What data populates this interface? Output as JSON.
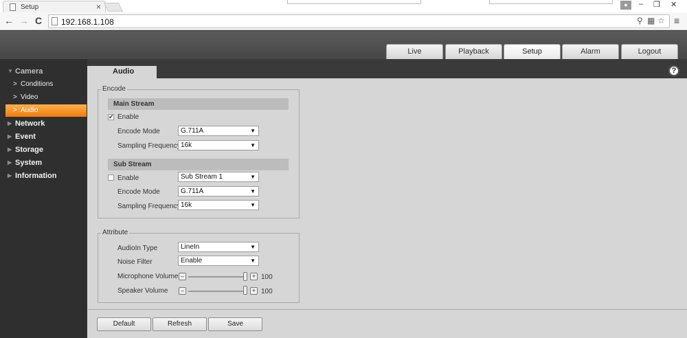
{
  "browser": {
    "tab_title": "Setup",
    "tab_close": "×",
    "back": "←",
    "forward": "→",
    "reload": "C",
    "url": "192.168.1.108",
    "menu": "≡",
    "window_controls": {
      "minimize": "–",
      "restore": "❐",
      "close": "✕"
    }
  },
  "topnav": [
    {
      "label": "Live"
    },
    {
      "label": "Playback"
    },
    {
      "label": "Setup",
      "active": true
    },
    {
      "label": "Alarm"
    },
    {
      "label": "Logout"
    }
  ],
  "sidebar": {
    "camera": "Camera",
    "conditions": "Conditions",
    "video": "Video",
    "audio": "Audio",
    "network": "Network",
    "event": "Event",
    "storage": "Storage",
    "system": "System",
    "information": "Information"
  },
  "content_tab": "Audio",
  "help": "?",
  "encode": {
    "legend": "Encode",
    "main_stream": {
      "title": "Main Stream",
      "enable_label": "Enable",
      "enabled": true,
      "encode_mode_label": "Encode Mode",
      "encode_mode": "G.711A",
      "sampling_label": "Sampling Frequency",
      "sampling": "16k"
    },
    "sub_stream": {
      "title": "Sub Stream",
      "enable_label": "Enable",
      "enabled": false,
      "stream_select": "Sub Stream 1",
      "encode_mode_label": "Encode Mode",
      "encode_mode": "G.711A",
      "sampling_label": "Sampling Frequency",
      "sampling": "16k"
    }
  },
  "attribute": {
    "legend": "Attribute",
    "audioin_label": "AudioIn Type",
    "audioin": "LineIn",
    "noise_label": "Noise Filter",
    "noise": "Enable",
    "mic_label": "Microphone Volume",
    "mic_value": "100",
    "speaker_label": "Speaker Volume",
    "speaker_value": "100"
  },
  "buttons": {
    "default": "Default",
    "refresh": "Refresh",
    "save": "Save"
  },
  "glyphs": {
    "arrow": "▼",
    "check": "✔",
    "minus": "–",
    "plus": "+",
    "chev": ">",
    "tri_down": "▼",
    "tri_right": "▶"
  }
}
